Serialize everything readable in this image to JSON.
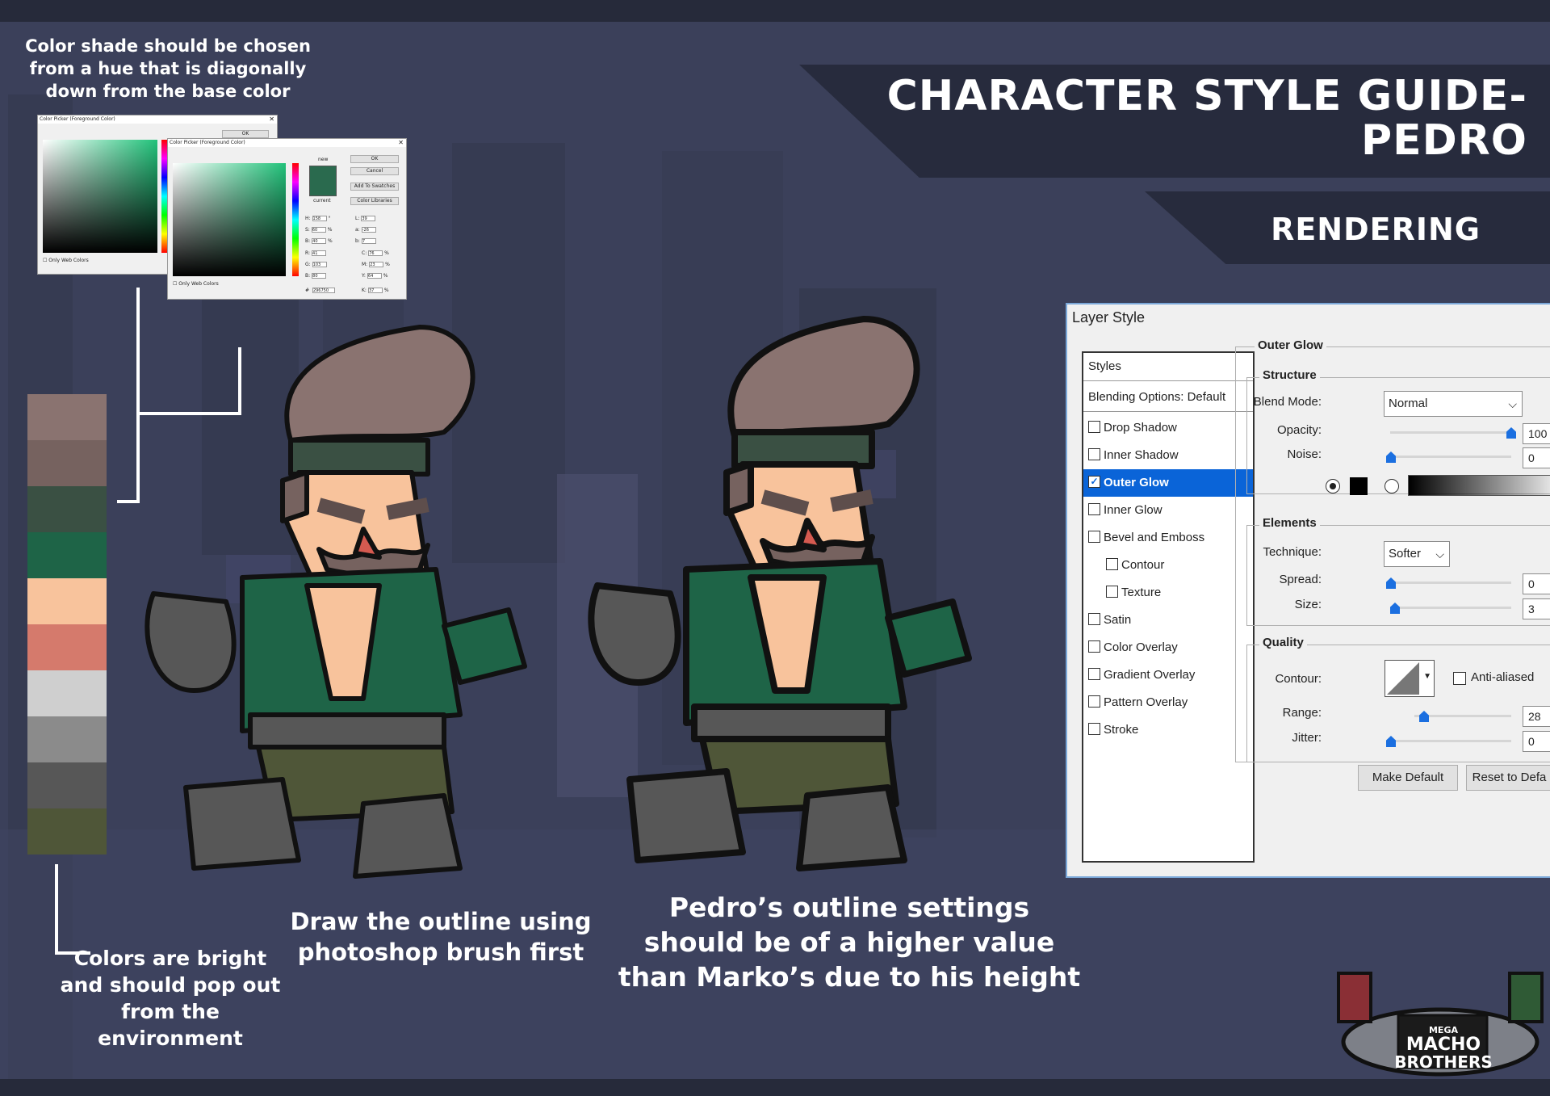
{
  "title": {
    "line1": "CHARACTER STYLE GUIDE-",
    "line2": "PEDRO"
  },
  "subtitle": "RENDERING",
  "notes": {
    "color_shade": "Color shade should be chosen from a hue that is diagonally down from the base color",
    "colors": "Colors are bright and should pop out from the environment",
    "outline": "Draw the outline using photoshop brush first",
    "settings": "Pedro’s outline settings should be of a higher value than Marko’s due to his height"
  },
  "swatches": [
    "#8a7370",
    "#76625f",
    "#3a5043",
    "#1e6447",
    "#f8c39c",
    "#d57a6c",
    "#cfcfcf",
    "#8b8b8b",
    "#575757",
    "#4f5638"
  ],
  "color_picker": {
    "title": "Color Picker (Foreground Color)",
    "ok": "OK",
    "cancel": "Cancel",
    "add_to_swatches": "Add To Swatches",
    "color_libraries": "Color Libraries",
    "new_label": "new",
    "current_label": "current",
    "only_web_colors": "Only Web Colors",
    "new_color": "#2a6a4e",
    "hex": "296750",
    "fields": {
      "H": "158",
      "S": "60",
      "B": "40",
      "R": "41",
      "G": "103",
      "Bv": "80",
      "L": "39",
      "a": "-26",
      "b": "7",
      "C": "76",
      "M": "23",
      "Y": "64",
      "K": "37"
    }
  },
  "layer_style": {
    "title": "Layer Style",
    "styles_header": "Styles",
    "blending": "Blending Options: Default",
    "items": [
      {
        "label": "Drop Shadow",
        "checked": false,
        "selected": false,
        "sub": false
      },
      {
        "label": "Inner Shadow",
        "checked": false,
        "selected": false,
        "sub": false
      },
      {
        "label": "Outer Glow",
        "checked": true,
        "selected": true,
        "sub": false
      },
      {
        "label": "Inner Glow",
        "checked": false,
        "selected": false,
        "sub": false
      },
      {
        "label": "Bevel and Emboss",
        "checked": false,
        "selected": false,
        "sub": false
      },
      {
        "label": "Contour",
        "checked": false,
        "selected": false,
        "sub": true
      },
      {
        "label": "Texture",
        "checked": false,
        "selected": false,
        "sub": true
      },
      {
        "label": "Satin",
        "checked": false,
        "selected": false,
        "sub": false
      },
      {
        "label": "Color Overlay",
        "checked": false,
        "selected": false,
        "sub": false
      },
      {
        "label": "Gradient Overlay",
        "checked": false,
        "selected": false,
        "sub": false
      },
      {
        "label": "Pattern Overlay",
        "checked": false,
        "selected": false,
        "sub": false
      },
      {
        "label": "Stroke",
        "checked": false,
        "selected": false,
        "sub": false
      }
    ],
    "outer_glow": "Outer Glow",
    "structure": "Structure",
    "blend_mode_label": "Blend Mode:",
    "blend_mode": "Normal",
    "opacity_label": "Opacity:",
    "opacity": "100",
    "noise_label": "Noise:",
    "noise": "0",
    "elements": "Elements",
    "technique_label": "Technique:",
    "technique": "Softer",
    "spread_label": "Spread:",
    "spread": "0",
    "size_label": "Size:",
    "size": "3",
    "quality": "Quality",
    "contour_label": "Contour:",
    "anti_aliased": "Anti-aliased",
    "range_label": "Range:",
    "range": "28",
    "jitter_label": "Jitter:",
    "jitter": "0",
    "make_default": "Make Default",
    "reset_default": "Reset to Defa"
  },
  "logo": {
    "top": "MEGA",
    "mid": "MACHO",
    "bottom": "BROTHERS"
  },
  "colors": {
    "skin": "#f8c39c",
    "jacket": "#1e6447",
    "hair": "#8a7370",
    "pants": "#4f5638",
    "outline": "#111111"
  }
}
